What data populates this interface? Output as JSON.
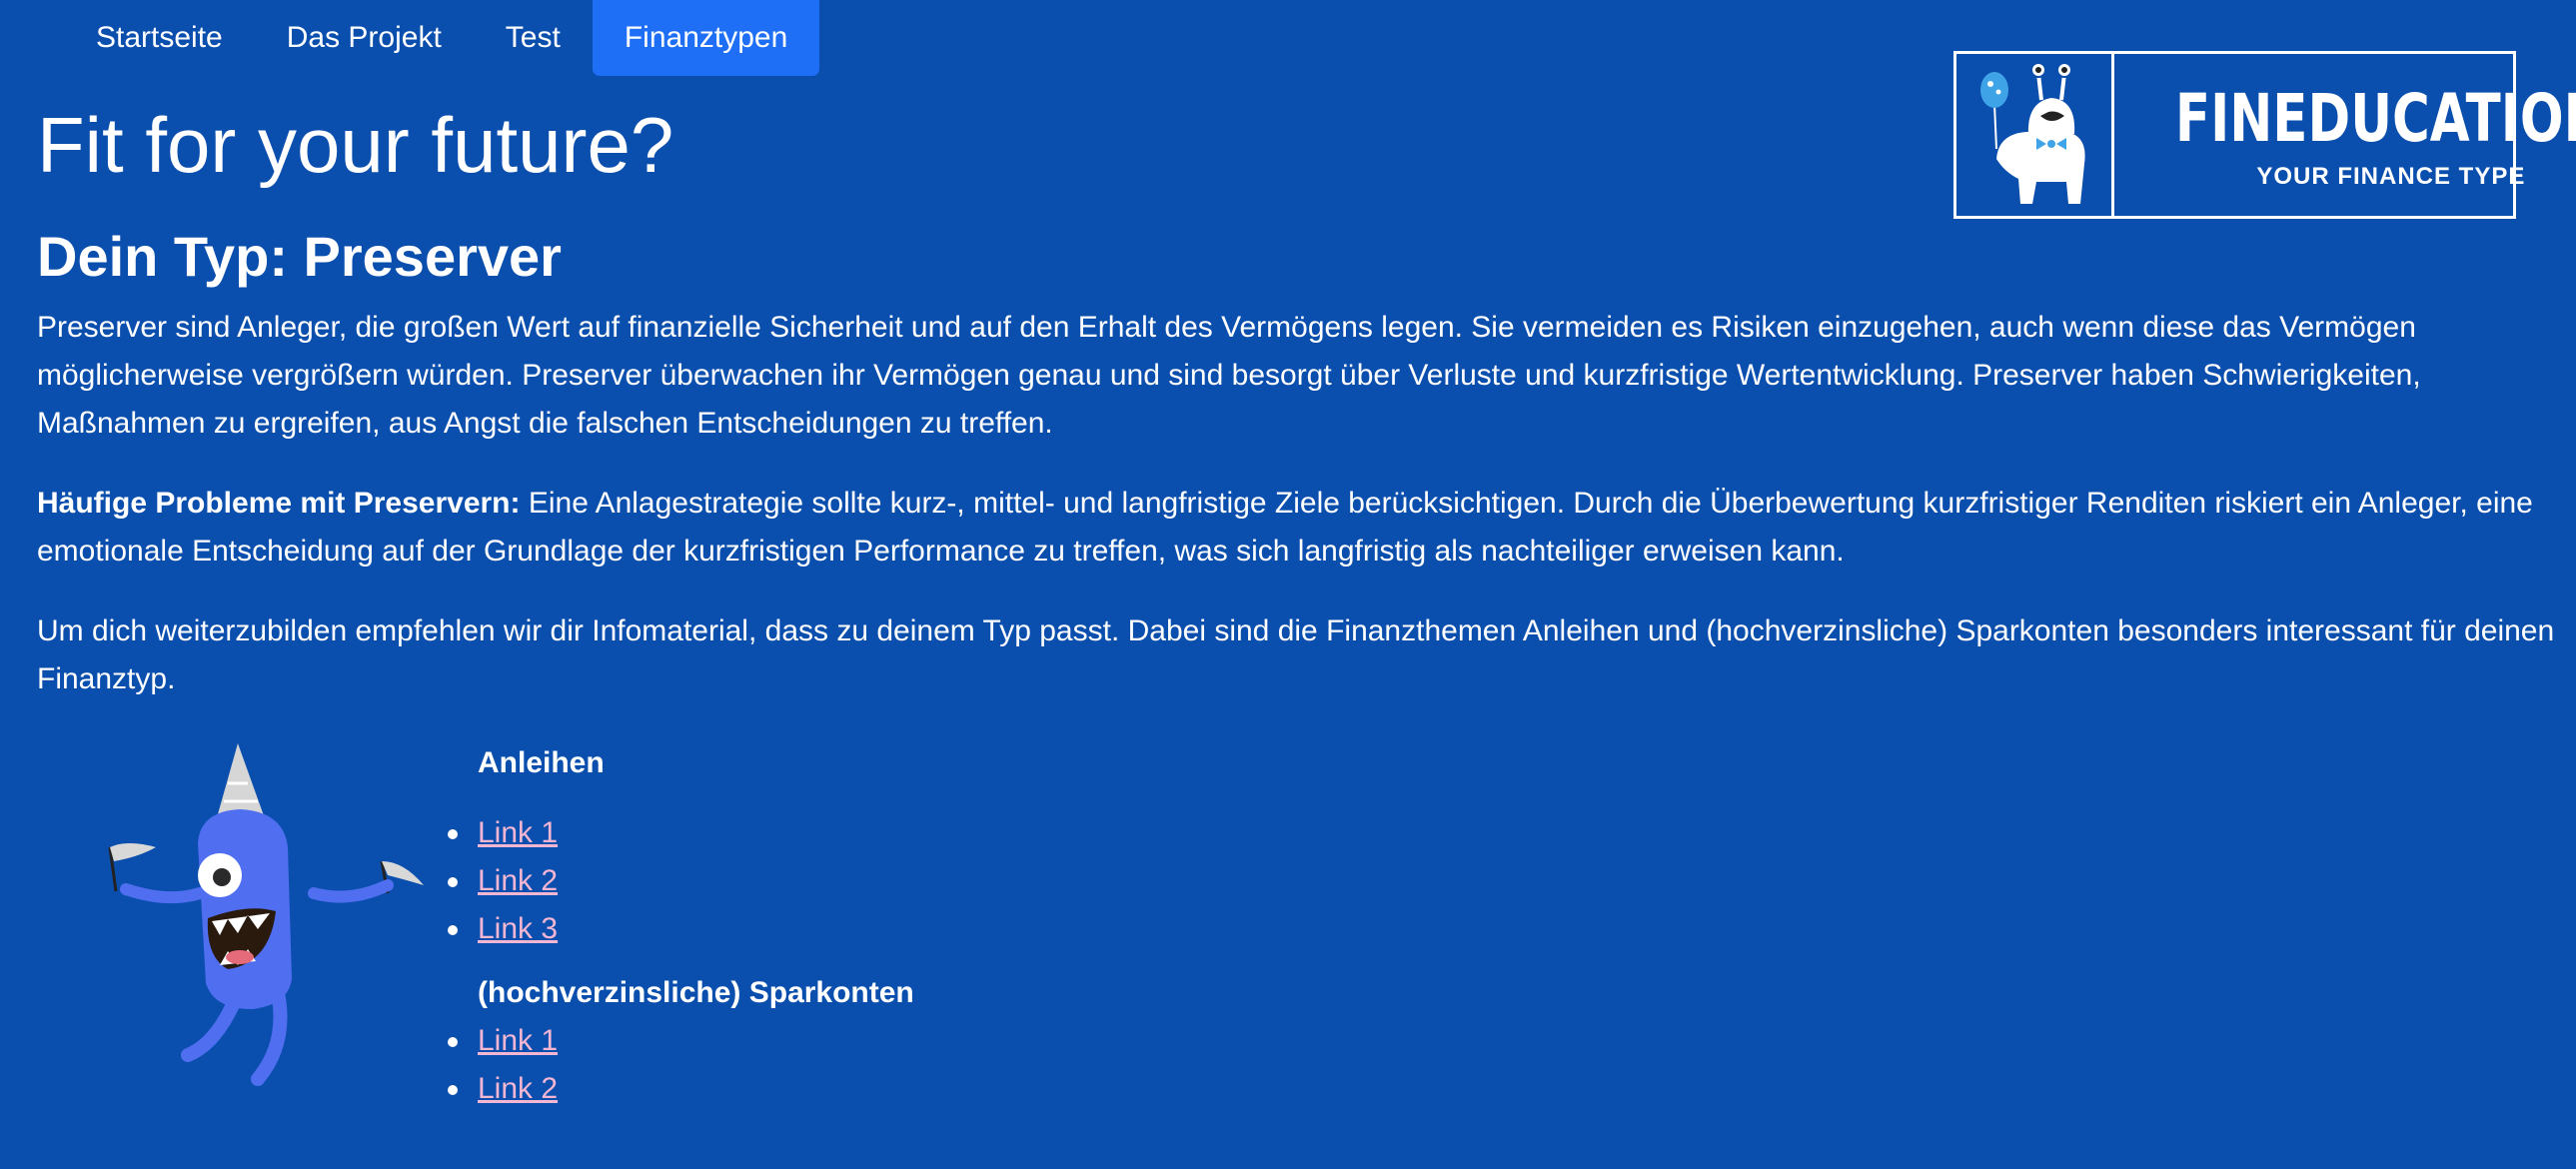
{
  "nav": {
    "items": [
      {
        "label": "Startseite"
      },
      {
        "label": "Das Projekt"
      },
      {
        "label": "Test"
      },
      {
        "label": "Finanztypen"
      }
    ],
    "active": "Finanztypen"
  },
  "logo": {
    "brand": "FINEDUCATION",
    "tagline": "YOUR FINANCE TYPE",
    "icon": "monster-mascot-icon"
  },
  "page": {
    "title": "Fit for your future?",
    "subtitle": "Dein Typ: Preserver",
    "paragraph1": "Preserver sind Anleger, die großen Wert auf finanzielle Sicherheit und auf den Erhalt des Vermögens legen. Sie vermeiden es Risiken einzugehen, auch wenn diese das Vermögen möglicherweise vergrößern würden. Preserver überwachen ihr Vermögen genau und sind besorgt über Verluste und kurzfristige Wertentwicklung. Preserver haben Schwierigkeiten, Maßnahmen zu ergreifen, aus Angst die falschen Entscheidungen zu treffen.",
    "paragraph2_bold": "Häufige Probleme mit Preservern:",
    "paragraph2": " Eine Anlagestrategie sollte kurz-, mittel- und langfristige Ziele berücksichtigen. Durch die Überbewertung kurzfristiger Renditen riskiert ein Anleger, eine emotionale Entscheidung auf der Grundlage der kurzfristigen Performance zu treffen, was sich langfristig als nachteiliger erweisen kann.",
    "paragraph3": "Um dich weiterzubilden empfehlen wir dir Infomaterial, dass zu deinem Typ passt. Dabei sind die Finanzthemen Anleihen und (hochverzinsliche) Sparkonten besonders interessant für deinen Finanztyp."
  },
  "topics": [
    {
      "title": "Anleihen",
      "links": [
        "Link 1",
        "Link 2",
        "Link 3"
      ]
    },
    {
      "title": "(hochverzinsliche) Sparkonten",
      "links": [
        "Link 1",
        "Link 2"
      ]
    }
  ],
  "colors": {
    "background": "#0b4fae",
    "nav_active": "#1e6ff5",
    "link": "#f4b6d2",
    "monster": "#4f6ef0"
  }
}
